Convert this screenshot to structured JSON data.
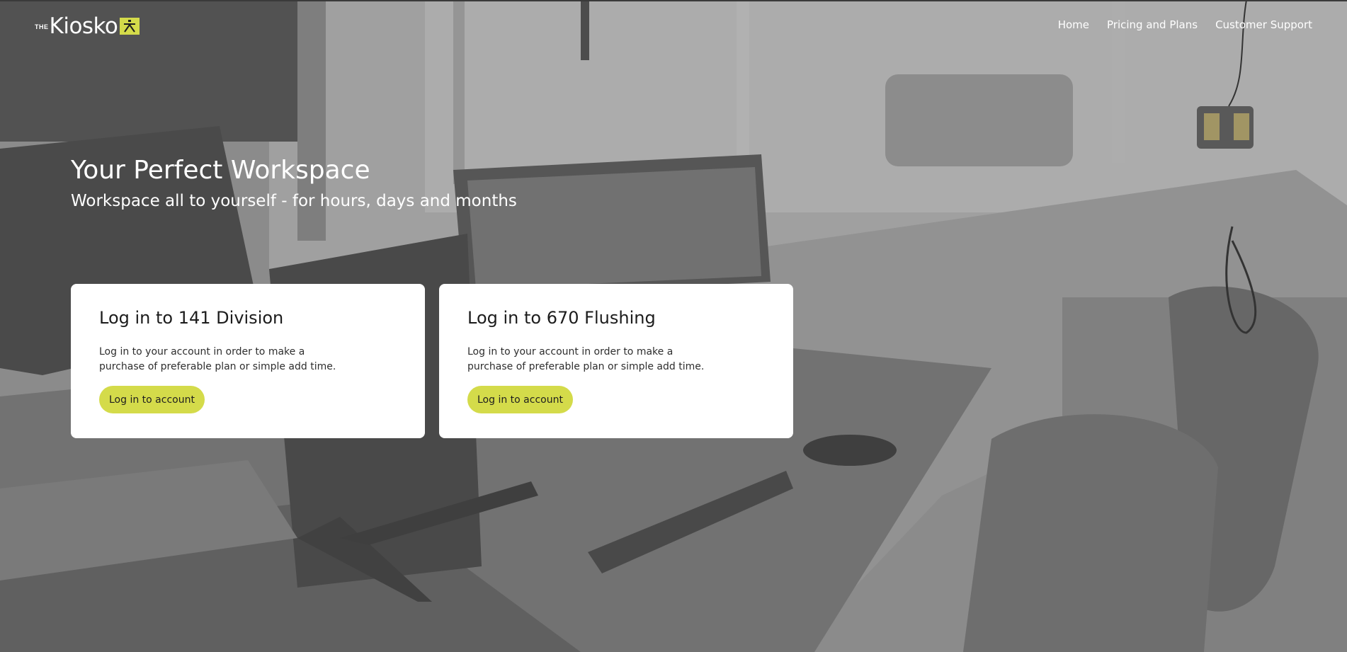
{
  "header": {
    "logo": {
      "the_text": "THE",
      "word": "Kiosko",
      "mark_icon": "kiosk-glyph-icon"
    },
    "nav": {
      "items": [
        {
          "label": "Home"
        },
        {
          "label": "Pricing and Plans"
        },
        {
          "label": "Customer Support"
        }
      ]
    }
  },
  "hero": {
    "title": "Your Perfect Workspace",
    "subtitle": "Workspace all to yourself - for hours, days and months"
  },
  "cards": [
    {
      "title": "Log in to 141 Division",
      "text": "Log in to your account in order to make a purchase of preferable plan or simple add time.",
      "button_label": "Log in to account"
    },
    {
      "title": "Log in to 670 Flushing",
      "text": "Log in to your account in order to make a purchase of preferable plan or simple add time.",
      "button_label": "Log in to account"
    }
  ],
  "colors": {
    "accent": "#d4db4a",
    "card_background": "#ffffff",
    "text_on_photo": "#ffffff"
  }
}
